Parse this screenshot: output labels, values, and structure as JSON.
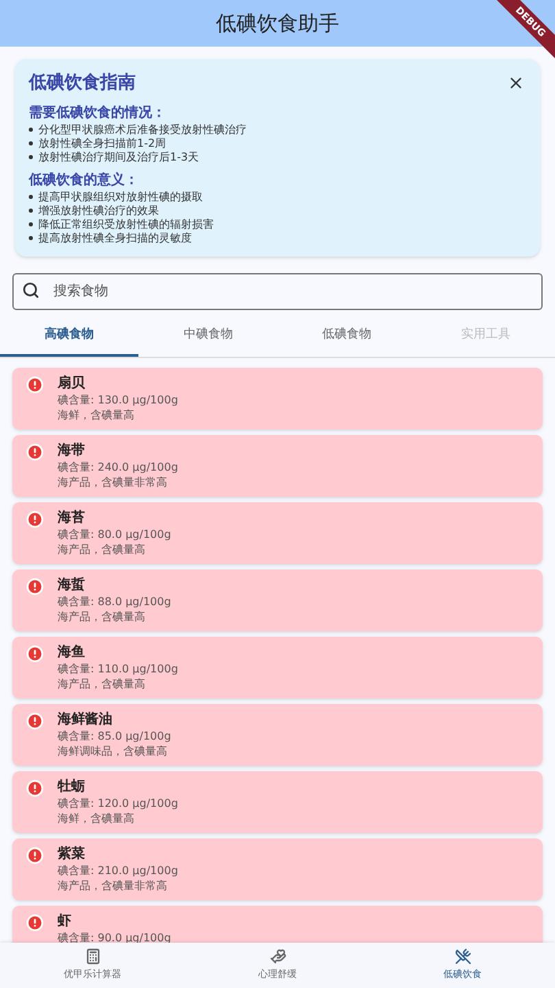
{
  "app_bar": {
    "title": "低碘饮食助手",
    "debug_banner": "DEBUG"
  },
  "guide": {
    "title": "低碘饮食指南",
    "sections": [
      {
        "heading": "需要低碘饮食的情况：",
        "items": [
          "分化型甲状腺癌术后准备接受放射性碘治疗",
          "放射性碘全身扫描前1-2周",
          "放射性碘治疗期间及治疗后1-3天"
        ]
      },
      {
        "heading": "低碘饮食的意义：",
        "items": [
          "提高甲状腺组织对放射性碘的摄取",
          "增强放射性碘治疗的效果",
          "降低正常组织受放射性碘的辐射损害",
          "提高放射性碘全身扫描的灵敏度"
        ]
      }
    ]
  },
  "search": {
    "placeholder": "搜索食物"
  },
  "tabs": [
    {
      "label": "高碘食物",
      "selected": true,
      "disabled": false
    },
    {
      "label": "中碘食物",
      "selected": false,
      "disabled": false
    },
    {
      "label": "低碘食物",
      "selected": false,
      "disabled": false
    },
    {
      "label": "实用工具",
      "selected": false,
      "disabled": true
    }
  ],
  "foods": [
    {
      "name": "扇贝",
      "iodine": "碘含量: 130.0 μg/100g",
      "note": "海鲜，含碘量高"
    },
    {
      "name": "海带",
      "iodine": "碘含量: 240.0 μg/100g",
      "note": "海产品，含碘量非常高"
    },
    {
      "name": "海苔",
      "iodine": "碘含量: 80.0 μg/100g",
      "note": "海产品，含碘量高"
    },
    {
      "name": "海蜇",
      "iodine": "碘含量: 88.0 μg/100g",
      "note": "海产品，含碘量高"
    },
    {
      "name": "海鱼",
      "iodine": "碘含量: 110.0 μg/100g",
      "note": "海产品，含碘量高"
    },
    {
      "name": "海鲜酱油",
      "iodine": "碘含量: 85.0 μg/100g",
      "note": "海鲜调味品，含碘量高"
    },
    {
      "name": "牡蛎",
      "iodine": "碘含量: 120.0 μg/100g",
      "note": "海鲜，含碘量高"
    },
    {
      "name": "紫菜",
      "iodine": "碘含量: 210.0 μg/100g",
      "note": "海产品，含碘量非常高"
    },
    {
      "name": "虾",
      "iodine": "碘含量: 90.0 μg/100g"
    }
  ],
  "bottom_nav": [
    {
      "label": "优甲乐计算器",
      "kind": "calculator",
      "selected": false
    },
    {
      "label": "心理舒缓",
      "kind": "relax",
      "selected": false
    },
    {
      "label": "低碘饮食",
      "kind": "diet",
      "selected": true
    }
  ]
}
